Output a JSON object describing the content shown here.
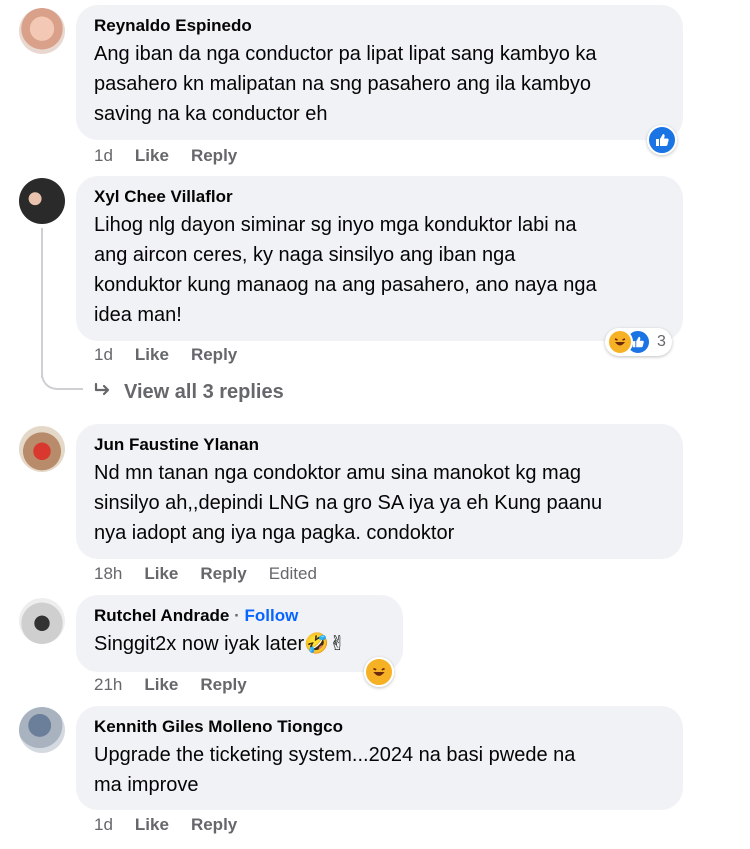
{
  "comments": [
    {
      "author": "Reynaldo Espinedo",
      "lines": [
        "Ang iban da nga conductor pa lipat lipat sang kambyo ka",
        "pasahero kn malipatan na sng pasahero ang ila kambyo",
        "saving na ka conductor eh"
      ],
      "time": "1d",
      "like": "Like",
      "reply": "Reply",
      "edited": ""
    },
    {
      "author": "Xyl Chee Villaflor",
      "lines": [
        "Lihog nlg dayon siminar sg inyo mga konduktor labi na",
        "ang aircon ceres, ky naga sinsilyo ang iban nga",
        "konduktor kung manaog na ang pasahero, ano naya nga",
        "idea man!"
      ],
      "time": "1d",
      "like": "Like",
      "reply": "Reply",
      "edited": "",
      "reaction_count": "3"
    },
    {
      "author": "Jun Faustine Ylanan",
      "lines": [
        "Nd mn tanan nga condoktor amu sina manokot kg mag",
        "sinsilyo ah,,depindi LNG na gro SA iya ya eh Kung paanu",
        "nya iadopt ang iya nga pagka. condoktor"
      ],
      "time": "18h",
      "like": "Like",
      "reply": "Reply",
      "edited": "Edited"
    },
    {
      "author": "Rutchel Andrade",
      "follow": "Follow",
      "lines": [
        "Singgit2x now iyak later🤣✌"
      ],
      "time": "21h",
      "like": "Like",
      "reply": "Reply",
      "edited": ""
    },
    {
      "author": "Kennith Giles Molleno Tiongco",
      "lines": [
        "Upgrade the ticketing system...2024 na basi pwede na",
        "ma improve"
      ],
      "time": "1d",
      "like": "Like",
      "reply": "Reply",
      "edited": ""
    }
  ],
  "view_replies": "View all 3 replies",
  "colors": {
    "bubble": "#f0f2f5",
    "link": "#0866ff",
    "meta": "#65676b",
    "like_blue": "#1b74e4",
    "haha_yellow": "#f7b125"
  },
  "icons": [
    "like-reaction-icon",
    "haha-reaction-icon",
    "reply-arrow-icon"
  ]
}
